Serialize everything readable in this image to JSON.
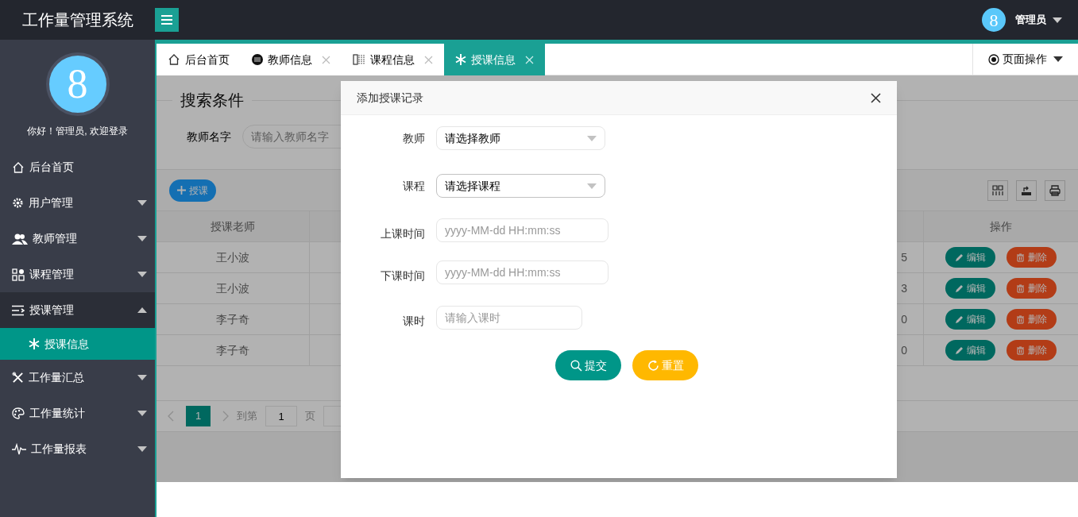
{
  "header": {
    "title": "工作量管理系统",
    "user": {
      "avatar": "8",
      "name": "管理员"
    }
  },
  "sidebar": {
    "avatar": "8",
    "greeting": "你好！管理员, 欢迎登录",
    "items": [
      {
        "label": "后台首页",
        "kind": "link",
        "selected": false
      },
      {
        "label": "用户管理",
        "kind": "group",
        "expanded": false,
        "selected": false
      },
      {
        "label": "教师管理",
        "kind": "group",
        "expanded": false,
        "selected": false
      },
      {
        "label": "课程管理",
        "kind": "group",
        "expanded": false,
        "selected": false
      },
      {
        "label": "授课管理",
        "kind": "group",
        "expanded": true,
        "selected": false,
        "children": [
          {
            "label": "授课信息",
            "selected": true
          }
        ]
      },
      {
        "label": "工作量汇总",
        "kind": "group",
        "expanded": false,
        "selected": false
      },
      {
        "label": "工作量统计",
        "kind": "group",
        "expanded": false,
        "selected": false
      },
      {
        "label": "工作量报表",
        "kind": "group",
        "expanded": false,
        "selected": false
      }
    ]
  },
  "tabs": [
    {
      "label": "后台首页",
      "selected": false,
      "closable": false
    },
    {
      "label": "教师信息",
      "selected": false,
      "closable": true
    },
    {
      "label": "课程信息",
      "selected": false,
      "closable": true
    },
    {
      "label": "授课信息",
      "selected": true,
      "closable": true
    }
  ],
  "page_actions": "页面操作",
  "search": {
    "legend": "搜索条件",
    "field_label": "教师名字",
    "placeholder": "请输入教师名字"
  },
  "toolbar": {
    "add_button": "授课"
  },
  "table": {
    "columns": [
      "授课老师",
      "操作"
    ],
    "rows": [
      {
        "teacher": "王小波",
        "column_2": "5",
        "actions": [
          "编辑",
          "删除"
        ]
      },
      {
        "teacher": "王小波",
        "column_2": "3",
        "actions": [
          "编辑",
          "删除"
        ]
      },
      {
        "teacher": "李子奇",
        "column_2": "0",
        "actions": [
          "编辑",
          "删除"
        ]
      },
      {
        "teacher": "李子奇",
        "column_2": "0",
        "actions": [
          "编辑",
          "删除"
        ]
      }
    ]
  },
  "pagination": {
    "current": "1",
    "goto_label": "到第",
    "goto_value": "1",
    "page_unit": "页"
  },
  "modal": {
    "title": "添加授课记录",
    "fields": [
      {
        "label": "教师",
        "kind": "select",
        "placeholder": "请选择教师"
      },
      {
        "label": "课程",
        "kind": "select",
        "placeholder": "请选择课程"
      },
      {
        "label": "上课时间",
        "kind": "input",
        "placeholder": "yyyy-MM-dd HH:mm:ss"
      },
      {
        "label": "下课时间",
        "kind": "input",
        "placeholder": "yyyy-MM-dd HH:mm:ss"
      },
      {
        "label": "课时",
        "kind": "input",
        "placeholder": "请输入课时"
      }
    ],
    "buttons": [
      {
        "label": "提交",
        "kind": "primary"
      },
      {
        "label": "重置",
        "kind": "warning"
      }
    ]
  }
}
